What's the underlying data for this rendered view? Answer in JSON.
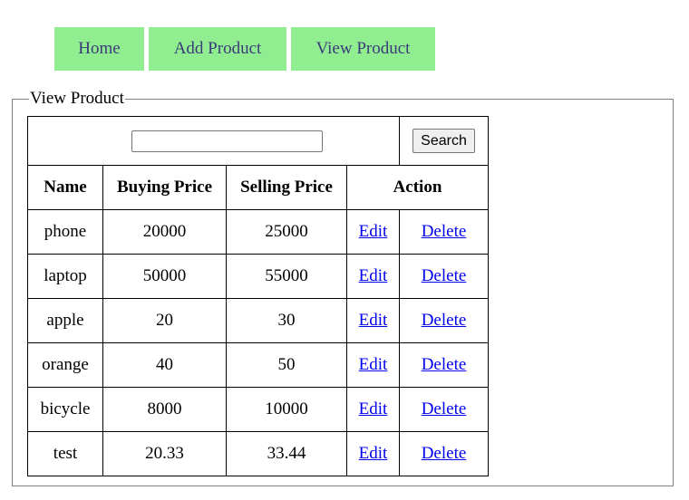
{
  "nav": {
    "home": "Home",
    "add_product": "Add Product",
    "view_product": "View Product",
    "color": "#90ee90"
  },
  "section": {
    "legend": "View Product"
  },
  "search": {
    "value": "",
    "placeholder": "",
    "button_label": "Search"
  },
  "table": {
    "headers": {
      "name": "Name",
      "buying_price": "Buying Price",
      "selling_price": "Selling Price",
      "action": "Action"
    },
    "rows": [
      {
        "name": "phone",
        "buying_price": "20000",
        "selling_price": "25000",
        "edit": "Edit",
        "delete": "Delete"
      },
      {
        "name": "laptop",
        "buying_price": "50000",
        "selling_price": "55000",
        "edit": "Edit",
        "delete": "Delete"
      },
      {
        "name": "apple",
        "buying_price": "20",
        "selling_price": "30",
        "edit": "Edit",
        "delete": "Delete"
      },
      {
        "name": "orange",
        "buying_price": "40",
        "selling_price": "50",
        "edit": "Edit",
        "delete": "Delete"
      },
      {
        "name": "bicycle",
        "buying_price": "8000",
        "selling_price": "10000",
        "edit": "Edit",
        "delete": "Delete"
      },
      {
        "name": "test",
        "buying_price": "20.33",
        "selling_price": "33.44",
        "edit": "Edit",
        "delete": "Delete"
      }
    ]
  }
}
